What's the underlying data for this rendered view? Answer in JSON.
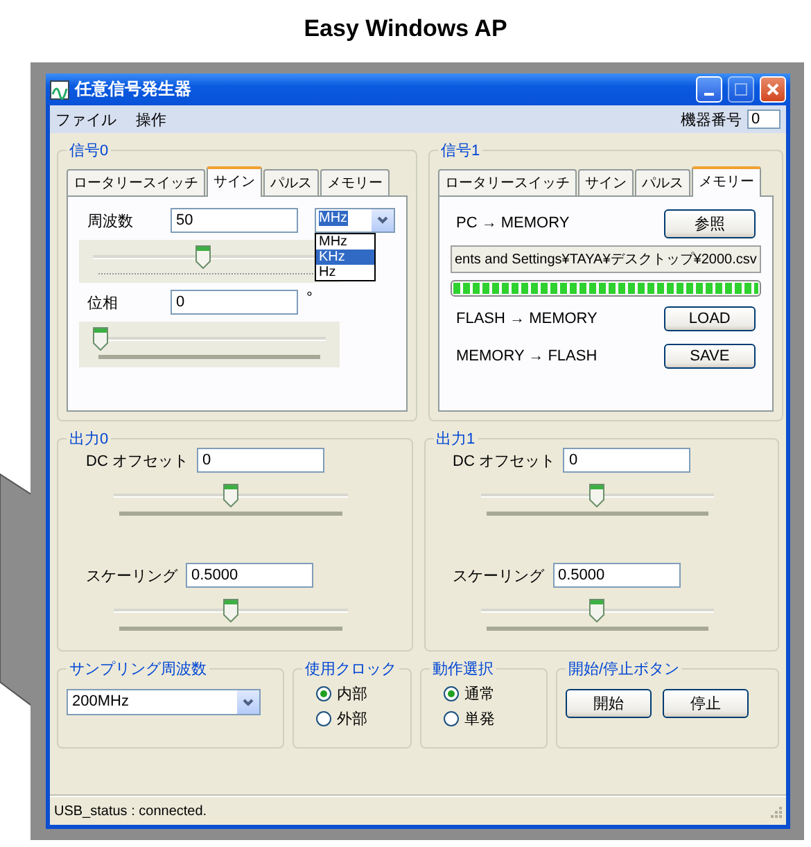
{
  "heading": "Easy Windows AP",
  "window": {
    "title": "任意信号発生器",
    "menu": [
      "ファイル",
      "操作"
    ],
    "device_number": {
      "label": "機器番号",
      "value": "0"
    }
  },
  "signals": [
    {
      "title": "信号0",
      "tabs": [
        {
          "label": "ロータリースイッチ",
          "selected": false
        },
        {
          "label": "サイン",
          "selected": true
        },
        {
          "label": "パルス",
          "selected": false
        },
        {
          "label": "メモリー",
          "selected": false
        }
      ],
      "kind": "sine",
      "frequency": {
        "label": "周波数",
        "value": "50",
        "unit": "MHz",
        "level": 0.47,
        "options": [
          {
            "label": "MHz",
            "selected": false
          },
          {
            "label": "KHz",
            "selected": true
          },
          {
            "label": "Hz",
            "selected": false
          }
        ]
      },
      "phase": {
        "label": "位相",
        "value": "0",
        "unit": "°",
        "level": 0
      }
    },
    {
      "title": "信号1",
      "tabs": [
        {
          "label": "ロータリースイッチ",
          "selected": false
        },
        {
          "label": "サイン",
          "selected": false
        },
        {
          "label": "パルス",
          "selected": false
        },
        {
          "label": "メモリー",
          "selected": true
        }
      ],
      "kind": "memory",
      "rows": [
        {
          "kind": "action",
          "label": "PC → MEMORY",
          "button": "参照"
        },
        {
          "kind": "path",
          "value": "ents and Settings¥TAYA¥デスクトップ¥2000.csv"
        },
        {
          "kind": "progress",
          "level": 1
        },
        {
          "kind": "action",
          "label": "FLASH → MEMORY",
          "button": "LOAD"
        },
        {
          "kind": "action",
          "label": "MEMORY → FLASH",
          "button": "SAVE"
        }
      ]
    }
  ],
  "outputs": [
    {
      "title": "出力0",
      "offset": {
        "label": "DC オフセット",
        "value": "0",
        "level": 0.5
      },
      "scaling": {
        "label": "スケーリング",
        "value": "0.5000",
        "level": 0.5
      }
    },
    {
      "title": "出力1",
      "offset": {
        "label": "DC オフセット",
        "value": "0",
        "level": 0.5
      },
      "scaling": {
        "label": "スケーリング",
        "value": "0.5000",
        "level": 0.5
      }
    }
  ],
  "sampling": {
    "title": "サンプリング周波数",
    "value": "200MHz"
  },
  "clock": {
    "title": "使用クロック",
    "options": [
      {
        "label": "内部",
        "selected": true
      },
      {
        "label": "外部",
        "selected": false
      }
    ]
  },
  "mode": {
    "title": "動作選択",
    "options": [
      {
        "label": "通常",
        "selected": true
      },
      {
        "label": "単発",
        "selected": false
      }
    ]
  },
  "start_stop": {
    "title": "開始/停止ボタン",
    "buttons": [
      "開始",
      "停止"
    ]
  },
  "status_bar": "USB_status : connected."
}
